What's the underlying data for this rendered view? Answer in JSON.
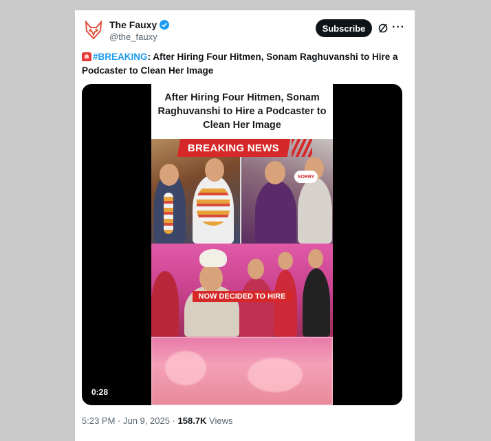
{
  "account": {
    "display_name": "The Fauxy",
    "handle": "@the_fauxy",
    "verified": true,
    "avatar_icon": "fox-logo-icon"
  },
  "actions": {
    "subscribe_label": "Subscribe",
    "grok_icon": "grok-icon",
    "more_icon": "more-icon",
    "more_glyph": "···"
  },
  "tweet": {
    "emoji": "siren-icon",
    "hashtag": "#BREAKING",
    "text": ": After Hiring Four Hitmen, Sonam Raghuvanshi to Hire a Podcaster to Clean Her Image"
  },
  "media": {
    "headline": "After Hiring Four Hitmen, Sonam Raghuvanshi to Hire a Podcaster to Clean Her Image",
    "banner": "BREAKING NEWS",
    "badge": "SORRY",
    "overlay_caption": "NOW DECIDED TO HIRE",
    "duration": "0:28"
  },
  "meta": {
    "time": "5:23 PM",
    "separator": " · ",
    "date": "Jun 9, 2025",
    "views_count": "158.7K",
    "views_label": " Views"
  },
  "colors": {
    "accent": "#1d9bf0",
    "breaking_red": "#d62828",
    "text": "#0f1419",
    "secondary": "#536471"
  }
}
